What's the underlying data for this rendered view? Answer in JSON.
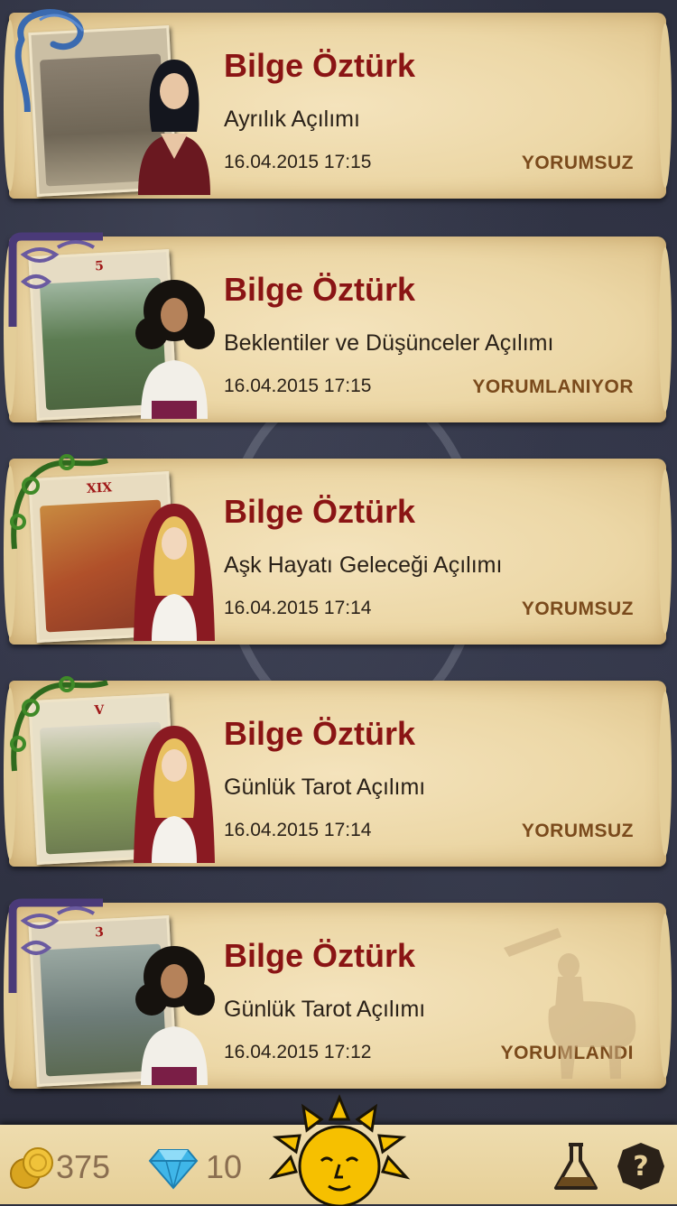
{
  "readings": [
    {
      "name": "Bilge Öztürk",
      "spread": "Ayrılık Açılımı",
      "datetime": "16.04.2015 17:15",
      "status": "YORUMSUZ",
      "card_numeral": "",
      "avatar": "dark-haired-witch",
      "ornament": "blue-serpent-icon"
    },
    {
      "name": "Bilge Öztürk",
      "spread": "Beklentiler ve Düşünceler Açılımı",
      "datetime": "16.04.2015 17:15",
      "status": "YORUMLANIYOR",
      "card_numeral": "5",
      "avatar": "curly-haired-fortune-teller",
      "ornament": "purple-celtic-knot-icon"
    },
    {
      "name": "Bilge Öztürk",
      "spread": "Aşk Hayatı Geleceği Açılımı",
      "datetime": "16.04.2015 17:14",
      "status": "YORUMSUZ",
      "card_numeral": "XIX",
      "avatar": "blonde-hooded-fortune-teller",
      "ornament": "green-vine-icon"
    },
    {
      "name": "Bilge Öztürk",
      "spread": "Günlük Tarot Açılımı",
      "datetime": "16.04.2015 17:14",
      "status": "YORUMSUZ",
      "card_numeral": "V",
      "avatar": "blonde-hooded-fortune-teller",
      "ornament": "green-vine-icon"
    },
    {
      "name": "Bilge Öztürk",
      "spread": "Günlük Tarot Açılımı",
      "datetime": "16.04.2015 17:12",
      "status": "YORUMLANDI",
      "card_numeral": "3",
      "avatar": "curly-haired-fortune-teller",
      "ornament": "purple-celtic-knot-icon"
    }
  ],
  "bottom_bar": {
    "coins": "375",
    "gems": "10",
    "coins_icon": "gold-coins-icon",
    "gems_icon": "diamond-icon",
    "center_icon": "sun-face-icon",
    "flask_icon": "flask-icon",
    "help_icon": "help-icon"
  },
  "colors": {
    "name": "#8a1414",
    "status": "#7a4a1c",
    "parchment": "#ecd7a6",
    "background": "#2f3140"
  }
}
